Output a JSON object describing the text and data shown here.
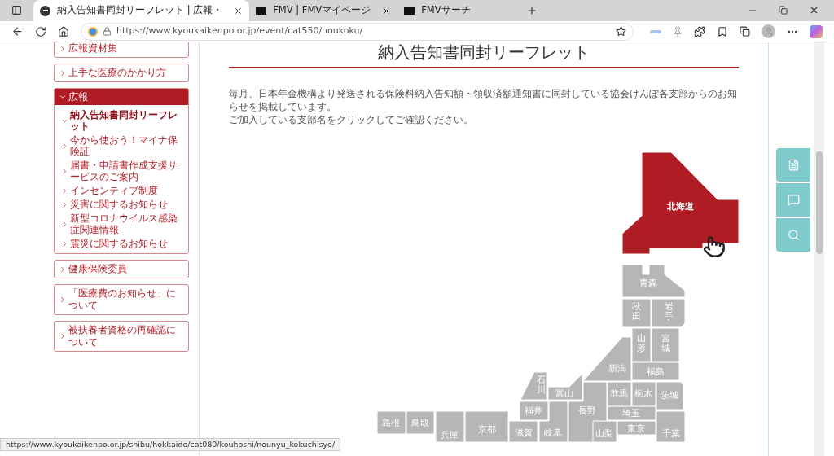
{
  "browser": {
    "tabs": [
      {
        "title": "納入告知書同封リーフレット | 広報・",
        "selected": true
      },
      {
        "title": "FMV | FMVマイページ",
        "selected": false
      },
      {
        "title": "FMVサーチ",
        "selected": false
      }
    ],
    "url": "https://www.kyoukaikenpo.or.jp/event/cat550/noukoku/"
  },
  "sidebar": {
    "items": [
      {
        "label": "広報資材集",
        "expanded": false
      },
      {
        "label": "上手な医療のかかり方",
        "expanded": false
      },
      {
        "label": "広報",
        "expanded": true,
        "children": [
          {
            "label": "納入告知書同封リーフレット",
            "selected": true
          },
          {
            "label": "今から使おう！マイナ保険証",
            "selected": false
          },
          {
            "label": "届書・申請書作成支援サービスのご案内",
            "selected": false
          },
          {
            "label": "インセンティブ制度",
            "selected": false
          },
          {
            "label": "災害に関するお知らせ",
            "selected": false
          },
          {
            "label": "新型コロナウイルス感染症関連情報",
            "selected": false
          },
          {
            "label": "震災に関するお知らせ",
            "selected": false
          }
        ]
      },
      {
        "label": "健康保険委員",
        "expanded": false
      },
      {
        "label": "「医療費のお知らせ」について",
        "expanded": false
      },
      {
        "label": "被扶養者資格の再確認について",
        "expanded": false
      }
    ]
  },
  "page": {
    "title": "納入告知書同封リーフレット",
    "paragraphs": [
      "毎月、日本年金機構より発送される保険料納入告知額・領収済額通知書に同封している協会けんぽ各支部からのお知らせを掲載しています。",
      "ご加入している支部名をクリックしてご確認ください。"
    ]
  },
  "map": {
    "prefectures": [
      {
        "name": "北海道",
        "highlighted": true
      },
      {
        "name": "青森",
        "highlighted": false
      },
      {
        "name": "秋田",
        "highlighted": false
      },
      {
        "name": "岩手",
        "highlighted": false
      },
      {
        "name": "山形",
        "highlighted": false
      },
      {
        "name": "宮城",
        "highlighted": false
      },
      {
        "name": "新潟",
        "highlighted": false
      },
      {
        "name": "福島",
        "highlighted": false
      },
      {
        "name": "石川",
        "highlighted": false
      },
      {
        "name": "富山",
        "highlighted": false
      },
      {
        "name": "群馬",
        "highlighted": false
      },
      {
        "name": "栃木",
        "highlighted": false
      },
      {
        "name": "茨城",
        "highlighted": false
      },
      {
        "name": "福井",
        "highlighted": false
      },
      {
        "name": "長野",
        "highlighted": false
      },
      {
        "name": "埼玉",
        "highlighted": false
      },
      {
        "name": "島根",
        "highlighted": false
      },
      {
        "name": "鳥取",
        "highlighted": false
      },
      {
        "name": "兵庫",
        "highlighted": false
      },
      {
        "name": "京都",
        "highlighted": false
      },
      {
        "name": "滋賀",
        "highlighted": false
      },
      {
        "name": "岐阜",
        "highlighted": false
      },
      {
        "name": "山梨",
        "highlighted": false
      },
      {
        "name": "東京",
        "highlighted": false
      },
      {
        "name": "千葉",
        "highlighted": false
      }
    ]
  },
  "status_bar": {
    "url": "https://www.kyoukaikenpo.or.jp/shibu/hokkaido/cat080/kouhoshi/nounyu_kokuchisyo/"
  }
}
